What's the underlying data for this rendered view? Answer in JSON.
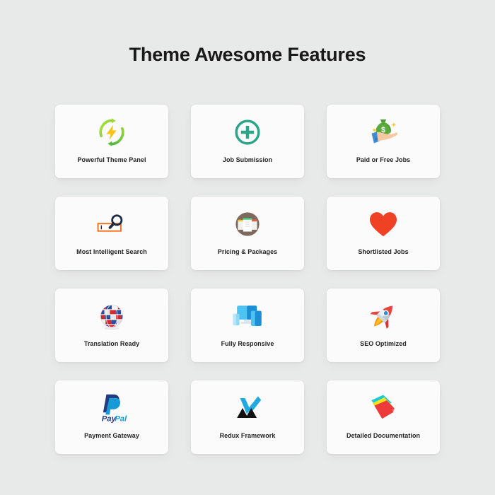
{
  "header": {
    "title": "Theme Awesome Features"
  },
  "colors": {
    "page_background": "#e8e9e9",
    "card_background": "#fbfbfb",
    "title_text": "#19191a",
    "label_text": "#232323",
    "green_arrow_light": "#a6e03a",
    "green_arrow_dark": "#5bbd3f",
    "lightning_yellow": "#fcc419",
    "teal_circle": "#2aa58a",
    "money_bag_green": "#5ba83f",
    "hand_skin": "#f7c8a0",
    "sleeve_blue": "#3d8dd4",
    "search_orange": "#f2711c",
    "magnifier_navy": "#1f2a44",
    "pricing_brown": "#7d6a5d",
    "heart_red": "#ef4123",
    "globe_blue": "#2c4f9e",
    "globe_red": "#cf2b33",
    "device_blue_light": "#4cc3f0",
    "device_blue_dark": "#1b8ed6",
    "rocket_red": "#e8453c",
    "rocket_gray": "#b9c6d1",
    "flame_orange": "#f7941e",
    "paypal_dark": "#253b80",
    "paypal_light": "#179bd7",
    "redux_blue": "#23a9e1",
    "redux_black": "#111111",
    "doc_cyan": "#1ac9d6",
    "doc_yellow": "#f6e31c",
    "doc_red": "#ed3a3a"
  },
  "features": [
    {
      "label": "Powerful Theme Panel",
      "icon": "refresh-lightning-icon"
    },
    {
      "label": "Job Submission",
      "icon": "plus-circle-icon"
    },
    {
      "label": "Paid or Free Jobs",
      "icon": "hand-money-bag-icon"
    },
    {
      "label": "Most Intelligent Search",
      "icon": "search-box-magnifier-icon"
    },
    {
      "label": "Pricing & Packages",
      "icon": "pricing-cards-circle-icon"
    },
    {
      "label": "Shortlisted Jobs",
      "icon": "heart-icon"
    },
    {
      "label": "Translation Ready",
      "icon": "flags-globe-icon"
    },
    {
      "label": "Fully Responsive",
      "icon": "devices-icon"
    },
    {
      "label": "SEO Optimized",
      "icon": "rocket-icon"
    },
    {
      "label": "Payment Gateway",
      "icon": "paypal-logo-icon"
    },
    {
      "label": "Redux Framework",
      "icon": "redux-logo-icon"
    },
    {
      "label": "Detailed Documentation",
      "icon": "documents-stack-icon"
    }
  ]
}
